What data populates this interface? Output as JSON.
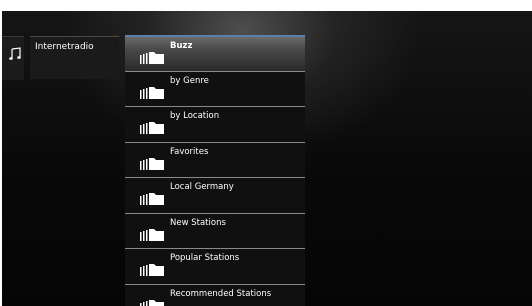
{
  "sidebar": {
    "icon": "music-note-icon",
    "category_label": "Internetradio"
  },
  "menu": {
    "item_icon": "folder-bars-icon",
    "selected_index": 0,
    "accent_color": "#5a7fa8",
    "items": [
      {
        "label": "Buzz"
      },
      {
        "label": "by Genre"
      },
      {
        "label": "by Location"
      },
      {
        "label": "Favorites"
      },
      {
        "label": "Local Germany"
      },
      {
        "label": "New Stations"
      },
      {
        "label": "Popular Stations"
      },
      {
        "label": "Recommended Stations"
      }
    ]
  }
}
